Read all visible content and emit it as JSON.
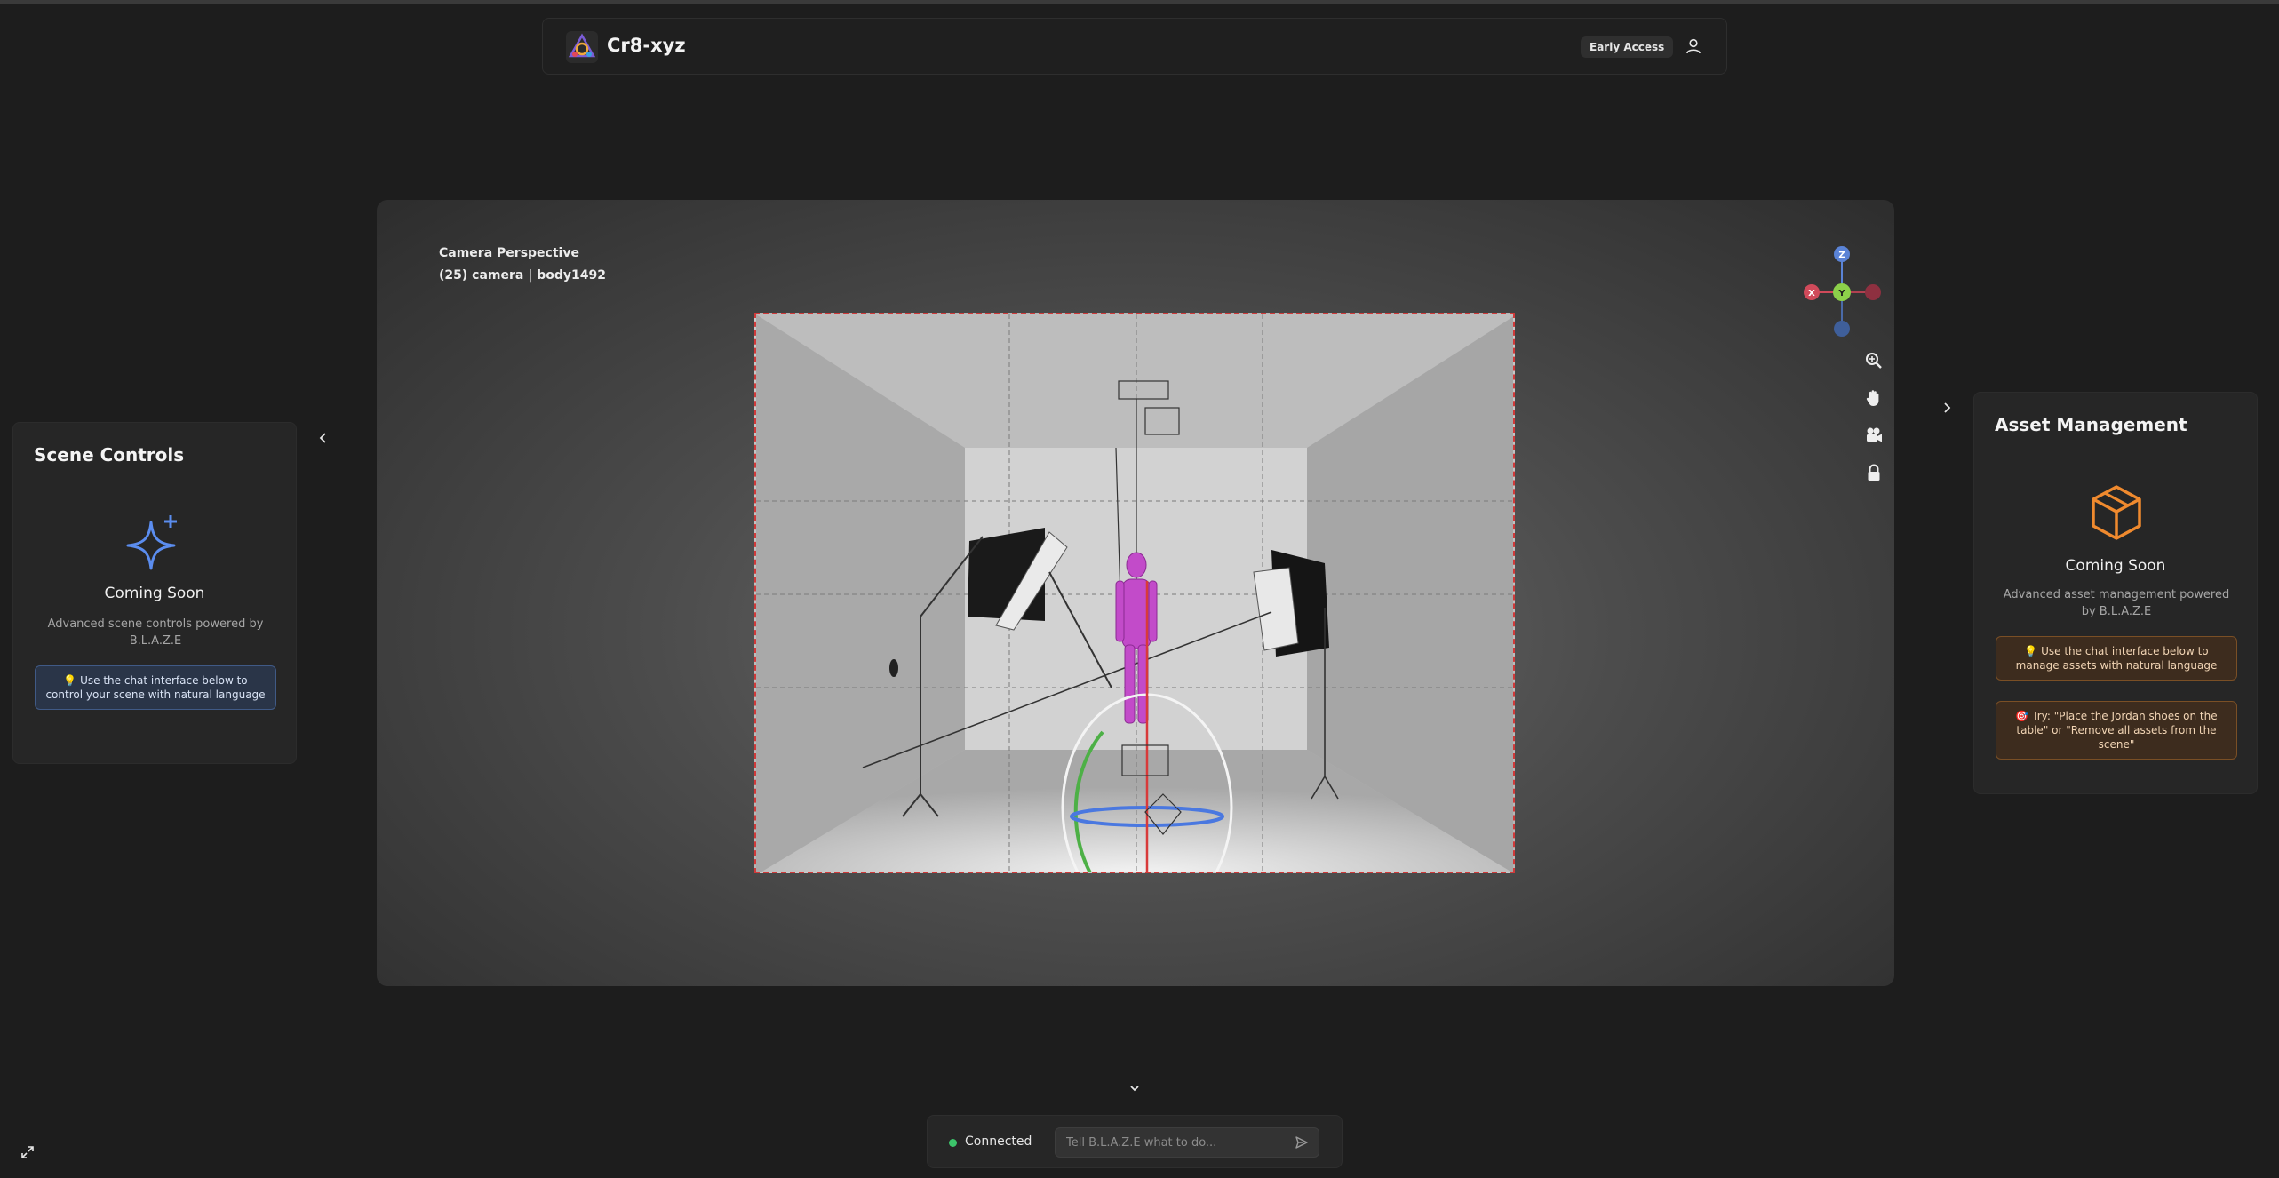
{
  "app": {
    "brand": "Cr8-xyz",
    "badge": "Early Access"
  },
  "viewport": {
    "camera_title": "Camera Perspective",
    "camera_subtitle": "(25) camera | body1492",
    "axes": {
      "z": "Z",
      "x": "X",
      "y": "Y"
    }
  },
  "scene_controls": {
    "title": "Scene Controls",
    "icon": "sparkles-icon",
    "status": "Coming Soon",
    "description": "Advanced scene controls powered by B.L.A.Z.E",
    "tip": "💡 Use the chat interface below to control your scene with natural language"
  },
  "asset_management": {
    "title": "Asset Management",
    "icon": "box-icon",
    "status": "Coming Soon",
    "description": "Advanced asset management powered by B.L.A.Z.E",
    "tip": "💡 Use the chat interface below to manage assets with natural language",
    "example": "🎯 Try: \"Place the Jordan shoes on the table\" or \"Remove all assets from the scene\""
  },
  "chat": {
    "status": "Connected",
    "placeholder": "Tell B.L.A.Z.E what to do..."
  },
  "colors": {
    "connected": "#3cc46a",
    "accent_blue": "#5b8def",
    "accent_orange": "#f08a2e",
    "frame_border": "#d03a3a"
  }
}
